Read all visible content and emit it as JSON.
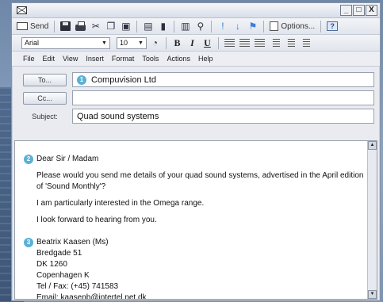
{
  "titlebar": {
    "controls": [
      "_",
      "□",
      "X"
    ]
  },
  "toolbar1": {
    "send_label": "Send",
    "options_label": "Options..."
  },
  "toolbar2": {
    "font": "Arial",
    "size": "10",
    "bold": "B",
    "italic": "I",
    "underline": "U"
  },
  "menu": [
    "File",
    "Edit",
    "View",
    "Insert",
    "Format",
    "Tools",
    "Actions",
    "Help"
  ],
  "fields": {
    "to_label": "To...",
    "to_badge": "1",
    "to_value": "Compuvision Ltd",
    "cc_label": "Cc...",
    "cc_value": "",
    "subject_label": "Subject:",
    "subject_value": "Quad sound systems"
  },
  "message": {
    "greeting_badge": "2",
    "greeting": "Dear Sir / Madam",
    "paragraphs": [
      "Please would you send me details of your quad sound systems, advertised in the April edition of 'Sound Monthly'?",
      "I am particularly interested in the Omega range.",
      "I look forward to hearing from you."
    ],
    "signature_badge": "3",
    "signature": [
      "Beatrix Kaasen (Ms)",
      "Bredgade 51",
      "DK 1260",
      "Copenhagen K",
      "Tel / Fax: (+45) 741583",
      "Email: kaasenb@intertel.net.dk"
    ]
  },
  "colors": {
    "badge": "#5cb0d6",
    "accent_blue": "#3d7fd6"
  },
  "icons": [
    "envelope-icon",
    "save-icon",
    "print-icon",
    "cut-icon",
    "copy-icon",
    "paste-icon",
    "address-book-icon",
    "attach-icon",
    "book-icon",
    "check-names-icon",
    "importance-high-icon",
    "importance-low-icon",
    "flag-icon",
    "options-icon",
    "help-icon",
    "font-color-icon",
    "align-left-icon",
    "align-center-icon",
    "align-right-icon",
    "bullets-icon",
    "decrease-indent-icon",
    "increase-indent-icon"
  ]
}
